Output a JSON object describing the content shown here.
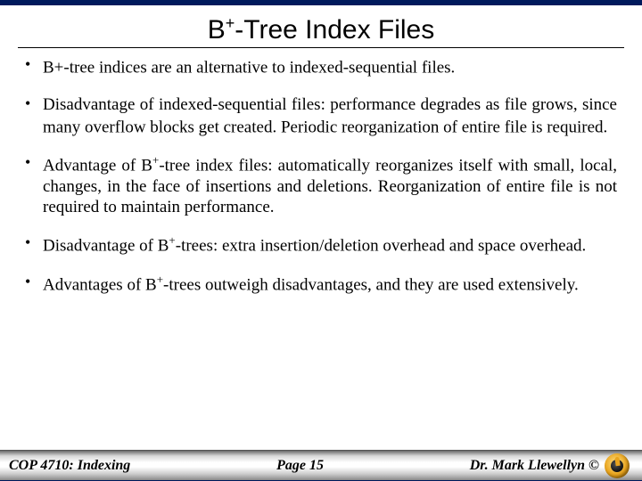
{
  "title": {
    "prefix": "B",
    "sup": "+",
    "suffix": "-Tree Index Files"
  },
  "bullets": [
    {
      "pre": "B+-tree indices are an alternative to indexed-sequential files.",
      "sup": "",
      "post": ""
    },
    {
      "pre": "Disadvantage of indexed-sequential files: performance degrades as file grows, since many overflow blocks get created.  Periodic reorganization of entire file is required.",
      "sup": "",
      "post": ""
    },
    {
      "pre": "Advantage of B",
      "sup": "+",
      "post": "-tree index files:  automatically reorganizes itself with small, local, changes, in the face of insertions and deletions.  Reorganization of entire file is not required to maintain performance."
    },
    {
      "pre": "Disadvantage of B",
      "sup": "+",
      "post": "-trees: extra insertion/deletion overhead and space overhead."
    },
    {
      "pre": "Advantages of B",
      "sup": "+",
      "post": "-trees outweigh disadvantages, and they are used extensively."
    }
  ],
  "footer": {
    "left": "COP 4710: Indexing",
    "center": "Page 15",
    "right": "Dr. Mark Llewellyn ©"
  }
}
